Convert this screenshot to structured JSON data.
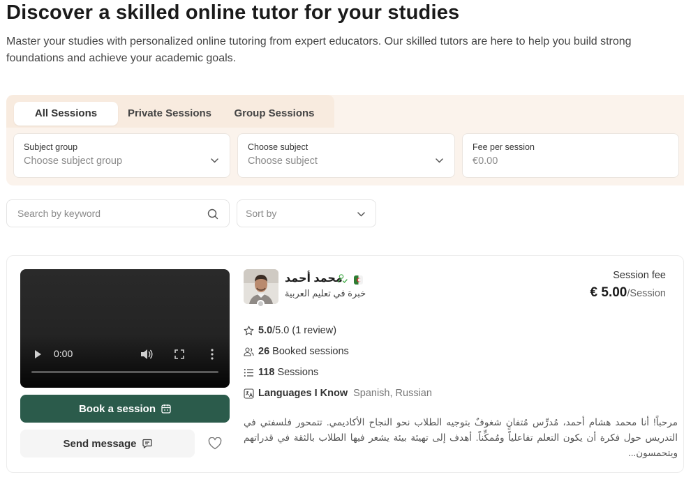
{
  "header": {
    "title": "Discover a skilled online tutor for your studies",
    "subtitle": "Master your studies with personalized online tutoring from expert educators. Our skilled tutors are here to help you build strong foundations and achieve your academic goals."
  },
  "tabs": [
    {
      "label": "All Sessions",
      "active": true
    },
    {
      "label": "Private Sessions",
      "active": false
    },
    {
      "label": "Group Sessions",
      "active": false
    }
  ],
  "filters": {
    "subject_group": {
      "label": "Subject group",
      "placeholder": "Choose subject group"
    },
    "subject": {
      "label": "Choose subject",
      "placeholder": "Choose subject"
    },
    "fee": {
      "label": "Fee per session",
      "placeholder": "€0.00"
    }
  },
  "search": {
    "placeholder": "Search by keyword"
  },
  "sort": {
    "placeholder": "Sort by"
  },
  "tutor": {
    "video_time": "0:00",
    "name": "محمد أحمد",
    "tagline": "خبرة في تعليم العربية",
    "fee_label": "Session fee",
    "fee_amount": "€ 5.00",
    "fee_unit": "/Session",
    "rating": "5.0",
    "rating_suffix": "/5.0 (1 review)",
    "booked_count": "26",
    "booked_label": "Booked sessions",
    "sessions_count": "118",
    "sessions_label": "Sessions",
    "languages_label": "Languages I Know",
    "languages": "Spanish, Russian",
    "bio": "مرحباً! أنا محمد هشام أحمد، مُدرِّس مُتفانٍ شغوفٌ بتوجيه الطلاب نحو النجاح الأكاديمي. تتمحور فلسفتي في التدريس حول فكرة أن يكون التعلم تفاعلياً ومُمكِّناً. أهدف إلى تهيئة بيئة يشعر فيها الطلاب بالثقة في قدراتهم ويتحمسون...",
    "book_label": "Book a session",
    "message_label": "Send message"
  },
  "colors": {
    "primary_button": "#2b5b4b",
    "panel_bg": "#fbf3ec",
    "tabs_bg": "#f8ebdf",
    "verified": "#4caf50"
  },
  "icons": [
    "chevron-down-icon",
    "search-icon",
    "play-icon",
    "volume-icon",
    "fullscreen-icon",
    "more-vertical-icon",
    "calendar-icon",
    "chat-icon",
    "heart-icon",
    "verified-user-icon",
    "flag-icon",
    "star-icon",
    "users-icon",
    "list-icon",
    "language-icon"
  ]
}
